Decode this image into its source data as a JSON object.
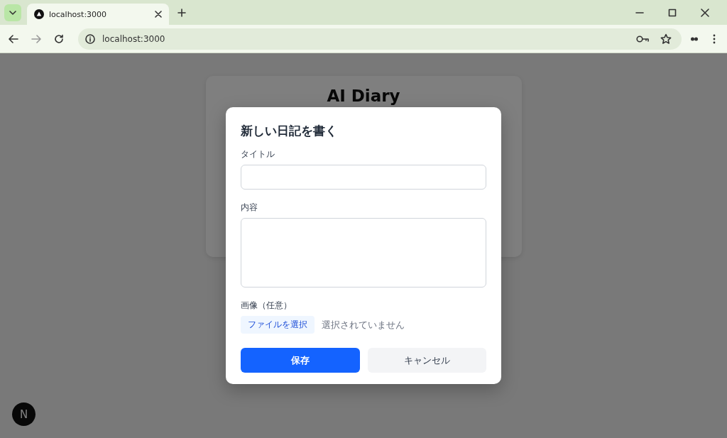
{
  "browser": {
    "tabs": [
      {
        "title": "localhost:3000",
        "selected": true
      }
    ],
    "address": "localhost:3000"
  },
  "page": {
    "heading": "AI Diary"
  },
  "dialog": {
    "title": "新しい日記を書く",
    "fields": [
      {
        "kind": "text",
        "label": "タイトル"
      },
      {
        "kind": "textarea",
        "label": "内容"
      },
      {
        "kind": "file",
        "label": "画像（任意）",
        "button": "ファイルを選択",
        "status": "選択されていません"
      }
    ],
    "buttons": [
      {
        "label": "保存",
        "kind": "primary"
      },
      {
        "label": "キャンセル",
        "kind": "secondary"
      }
    ]
  },
  "dev_badge": {
    "label": "N"
  }
}
